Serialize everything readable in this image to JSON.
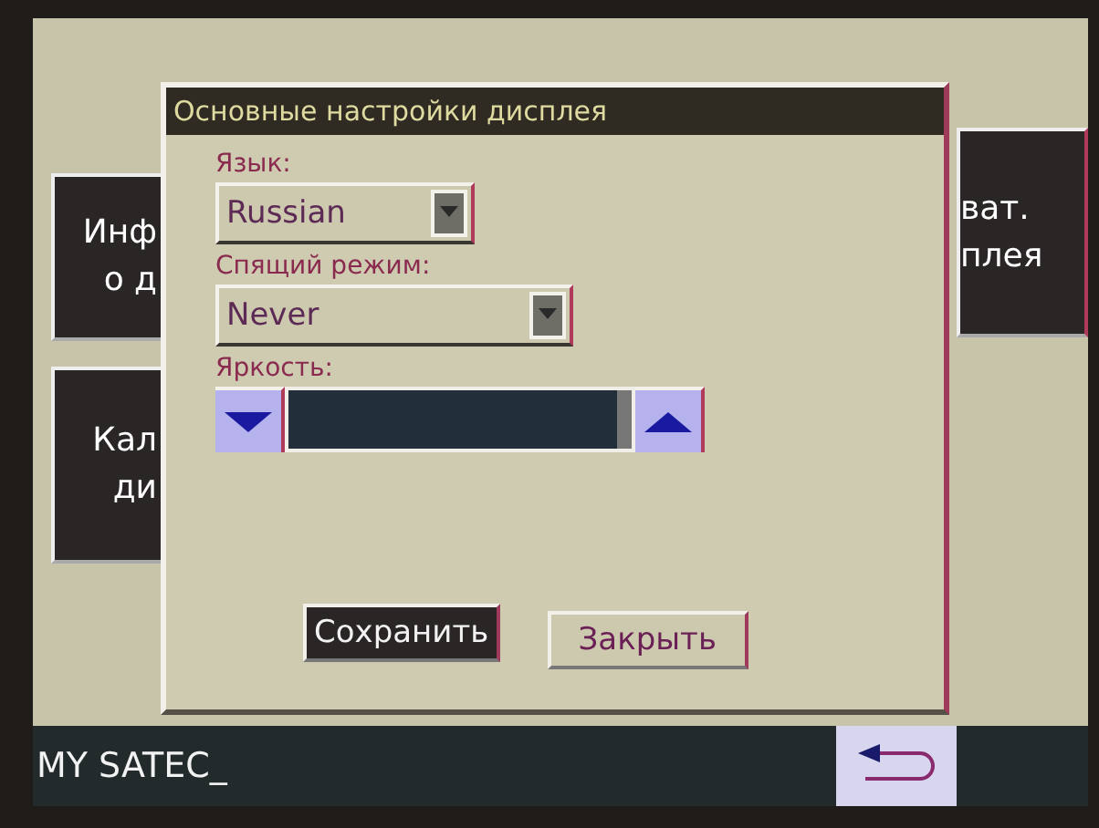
{
  "background_tiles": [
    {
      "lines": [
        "Инф",
        "о д"
      ],
      "kind": "left"
    },
    {
      "lines": [
        "Кал",
        "ди"
      ],
      "kind": "left"
    },
    {
      "lines": [
        "ват.",
        "плея"
      ],
      "kind": "right"
    }
  ],
  "dialog": {
    "title": "Основные настройки дисплея",
    "fields": [
      {
        "kind": "dropdown",
        "label": "Язык:",
        "value": "Russian"
      },
      {
        "kind": "dropdown",
        "label": "Спящий режим:",
        "value": "Never"
      },
      {
        "kind": "slider",
        "label": "Яркость:",
        "level": 1
      }
    ],
    "buttons": [
      {
        "label": "Сохранить",
        "selected": true
      },
      {
        "label": "Закрыть",
        "selected": false
      }
    ]
  },
  "status_bar": {
    "text": "MY SATEC_"
  }
}
